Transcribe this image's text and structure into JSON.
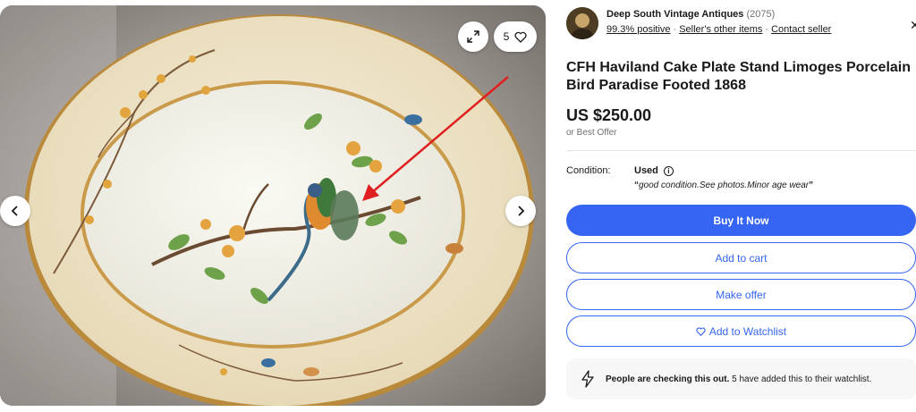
{
  "gallery": {
    "watch_count": "5",
    "icons": [
      "chevron-left-icon",
      "chevron-right-icon",
      "expand-icon",
      "heart-icon"
    ]
  },
  "seller": {
    "name": "Deep South Vintage Antiques",
    "feedback_count": "(2075)",
    "positive": "99.3% positive",
    "other_items": "Seller's other items",
    "contact": "Contact seller"
  },
  "listing": {
    "title": "CFH Haviland Cake Plate Stand Limoges Porcelain Bird Paradise Footed 1868",
    "price": "US $250.00",
    "best_offer": "or Best Offer",
    "condition_label": "Condition:",
    "condition_value": "Used",
    "condition_note_open": "“",
    "condition_note": "good condition.See photos.Minor age wear",
    "condition_note_close": "”"
  },
  "actions": {
    "buy_now": "Buy It Now",
    "add_to_cart": "Add to cart",
    "make_offer": "Make offer",
    "add_to_watchlist": "Add to Watchlist"
  },
  "notice": {
    "bold": "People are checking this out.",
    "text": " 5 have added this to their watchlist."
  },
  "colors": {
    "accent": "#3665f3",
    "text": "#191919",
    "muted": "#707070"
  }
}
